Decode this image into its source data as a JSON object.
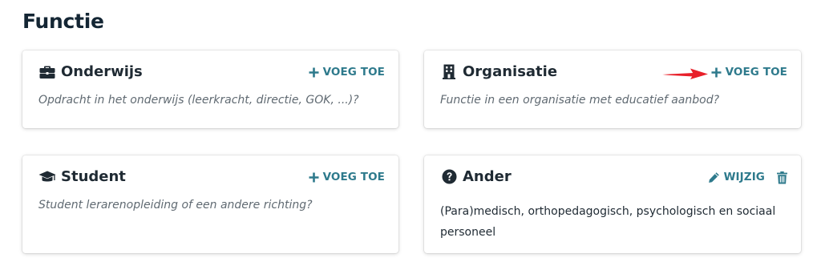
{
  "page": {
    "title": "Functie"
  },
  "colors": {
    "accent": "#2e7a8c",
    "arrow": "#e8202a",
    "title": "#142634"
  },
  "cards": [
    {
      "title": "Onderwijs",
      "icon": "briefcase-icon",
      "description": "Opdracht in het onderwijs (leerkracht, directie, GOK, ...)?",
      "action_label": "VOEG TOE"
    },
    {
      "title": "Organisatie",
      "icon": "building-icon",
      "description": "Functie in een organisatie met educatief aanbod?",
      "action_label": "VOEG TOE"
    },
    {
      "title": "Student",
      "icon": "graduation-cap-icon",
      "description": "Student lerarenopleiding of een andere richting?",
      "action_label": "VOEG TOE"
    },
    {
      "title": "Ander",
      "icon": "question-circle-icon",
      "value": "(Para)medisch, orthopedagogisch, psychologisch en sociaal personeel",
      "action_label": "WIJZIG",
      "delete_icon": "trash-icon"
    }
  ],
  "annotation": {
    "icon": "red-arrow-icon"
  }
}
